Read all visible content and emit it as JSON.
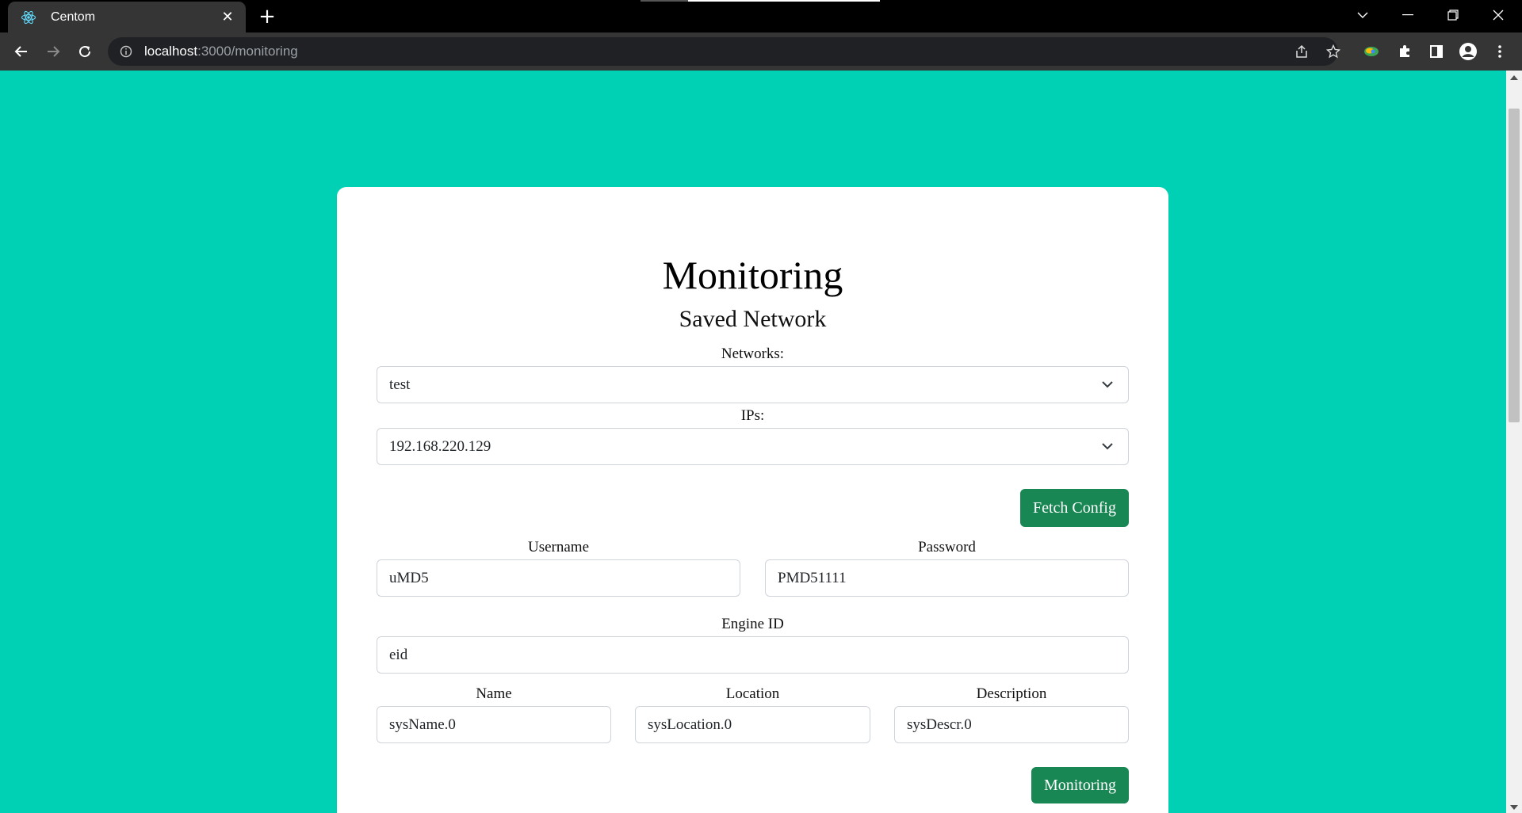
{
  "browser": {
    "tab_title": "Centom",
    "tab_close": "✕",
    "new_tab": "+",
    "url_host": "localhost",
    "url_path": ":3000/monitoring",
    "icons": [
      "react-favicon-icon",
      "back-arrow-icon",
      "forward-arrow-icon",
      "reload-icon",
      "info-icon",
      "share-icon",
      "star-icon",
      "extension-colorful-icon",
      "puzzle-icon",
      "side-panel-icon",
      "profile-icon",
      "kebab-menu-icon",
      "tab-search-chevron-icon",
      "minimize-icon",
      "restore-icon",
      "close-window-icon"
    ]
  },
  "page": {
    "title": "Monitoring",
    "subtitle": "Saved Network",
    "networks_label": "Networks:",
    "networks_value": "test",
    "ips_label": "IPs:",
    "ips_value": "192.168.220.129",
    "fetch_button": "Fetch Config",
    "username_label": "Username",
    "username_value": "uMD5",
    "password_label": "Password",
    "password_value": "PMD51111",
    "engine_label": "Engine ID",
    "engine_value": "eid",
    "name_label": "Name",
    "name_value": "sysName.0",
    "location_label": "Location",
    "location_value": "sysLocation.0",
    "description_label": "Description",
    "description_value": "sysDescr.0",
    "monitoring_button": "Monitoring"
  },
  "colors": {
    "background": "#00d0b4",
    "button": "#198754",
    "card": "#ffffff"
  }
}
